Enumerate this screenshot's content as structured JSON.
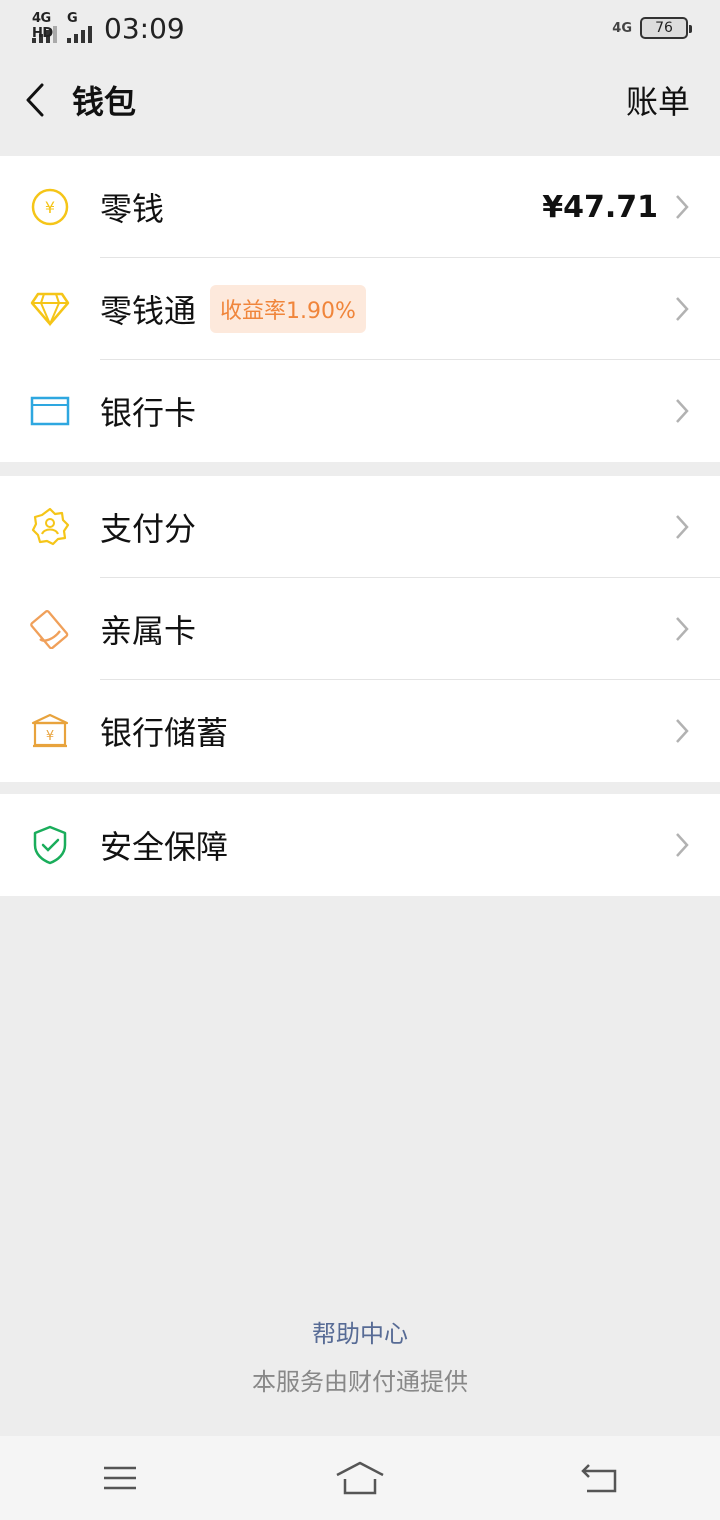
{
  "status_bar": {
    "left_network_1": "4G HD",
    "left_network_2": "G",
    "time": "03:09",
    "right_network": "4G",
    "battery": "76"
  },
  "header": {
    "title": "钱包",
    "right_action": "账单"
  },
  "groups": [
    {
      "items": [
        {
          "label": "零钱",
          "value": "¥47.71",
          "icon": "coin-icon"
        },
        {
          "label": "零钱通",
          "badge": "收益率1.90%",
          "icon": "diamond-icon"
        },
        {
          "label": "银行卡",
          "icon": "card-icon"
        }
      ]
    },
    {
      "items": [
        {
          "label": "支付分",
          "icon": "payscore-icon"
        },
        {
          "label": "亲属卡",
          "icon": "family-card-icon"
        },
        {
          "label": "银行储蓄",
          "icon": "bank-savings-icon"
        }
      ]
    },
    {
      "items": [
        {
          "label": "安全保障",
          "icon": "shield-icon"
        }
      ]
    }
  ],
  "footer": {
    "help": "帮助中心",
    "provider": "本服务由财付通提供"
  },
  "colors": {
    "coin": "#f5c518",
    "diamond": "#f5c518",
    "card": "#2ea7e0",
    "payscore": "#f5c518",
    "family": "#f0a05a",
    "bank": "#e8a33d",
    "shield": "#1aad5b",
    "link": "#576b95",
    "badge_bg": "#fde9dc",
    "badge_text": "#f0853b"
  }
}
